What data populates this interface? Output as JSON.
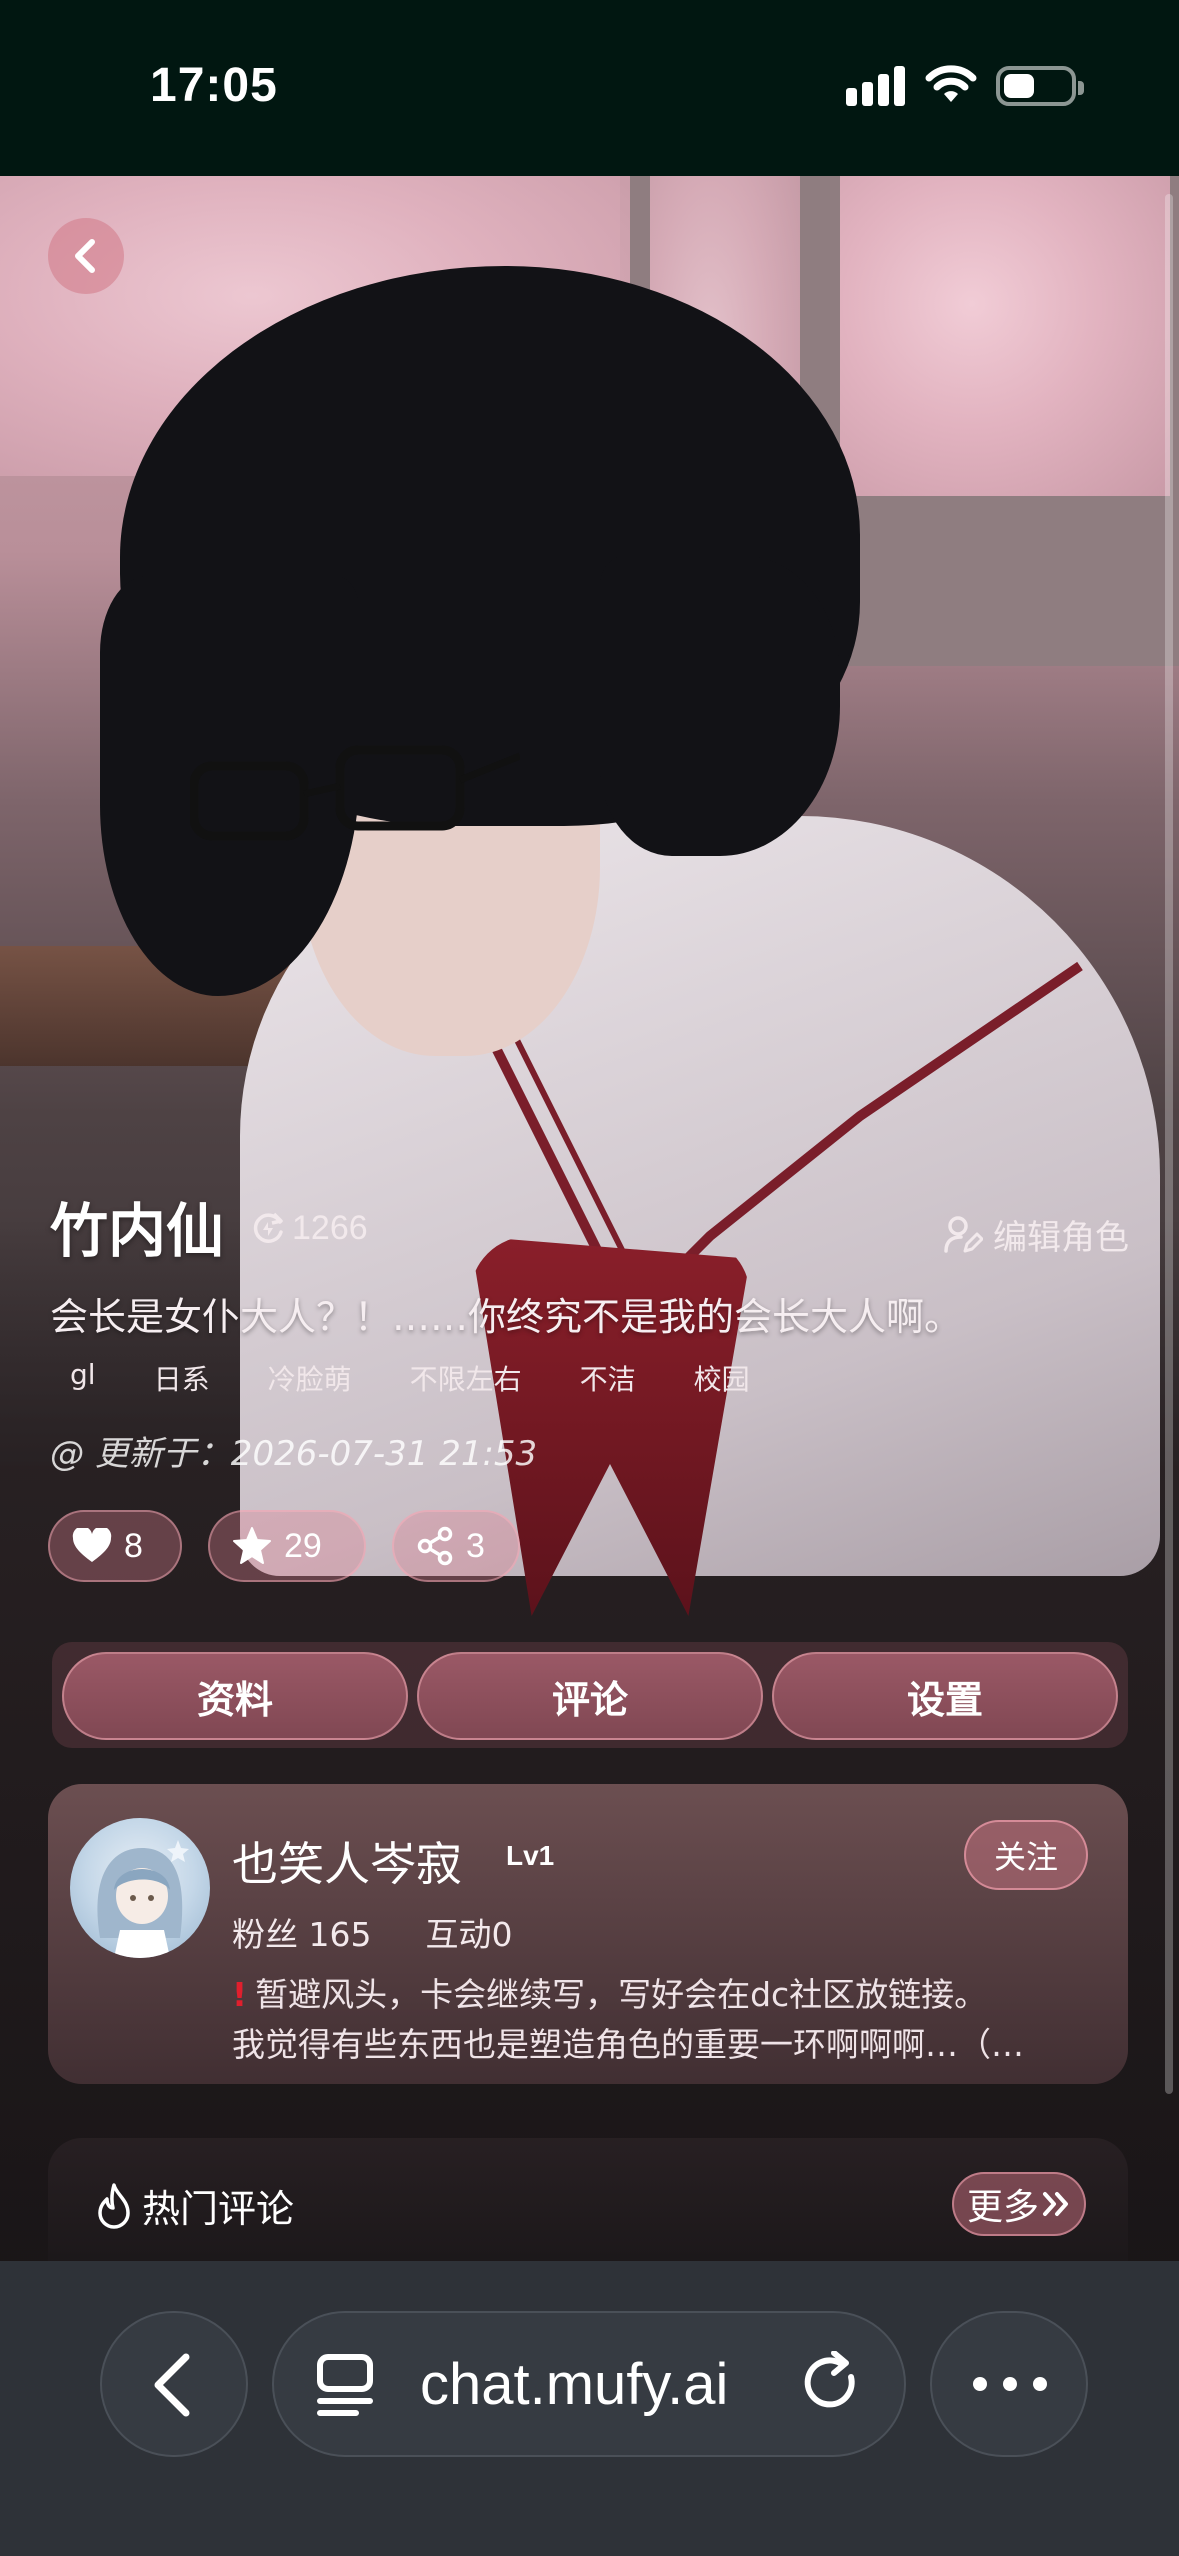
{
  "status_bar": {
    "time": "17:05"
  },
  "character": {
    "name": "竹内仙",
    "hot_count": "1266",
    "edit_label": "编辑角色",
    "intro": "会长是女仆大人？！……你终究不是我的会长大人啊。",
    "tags": [
      "gl",
      "日系",
      "冷脸萌",
      "不限左右",
      "不洁",
      "校园"
    ],
    "updated": "@ 更新于：2026-07-31 21:53"
  },
  "stats": {
    "likes": "8",
    "favorites": "29",
    "shares": "3"
  },
  "tabs": [
    "资料",
    "评论",
    "设置"
  ],
  "author": {
    "name": "也笑人岑寂",
    "level": "Lv1",
    "follow_label": "关注",
    "fans": "粉丝 165",
    "interactions": "互动0",
    "bio_line1": "暂避风头，卡会继续写，写好会在dc社区放链接。",
    "bio_line2": "我觉得有些东西也是塑造角色的重要一环啊啊啊…（…"
  },
  "hot_comments": {
    "title": "热门评论",
    "more_label": "更多"
  },
  "browser": {
    "url": "chat.mufy.ai"
  },
  "colors": {
    "status_bar_bg": "#011711",
    "accent_pink": "#c8788a",
    "browser_bar_bg": "#2e3238"
  },
  "icons": [
    "back-chevron-icon",
    "hot-refresh-icon",
    "edit-user-icon",
    "heart-icon",
    "star-icon",
    "share-icon",
    "fire-icon",
    "double-chevron-right-icon",
    "browser-back-icon",
    "tabs-icon",
    "reload-icon",
    "more-dots-icon"
  ]
}
